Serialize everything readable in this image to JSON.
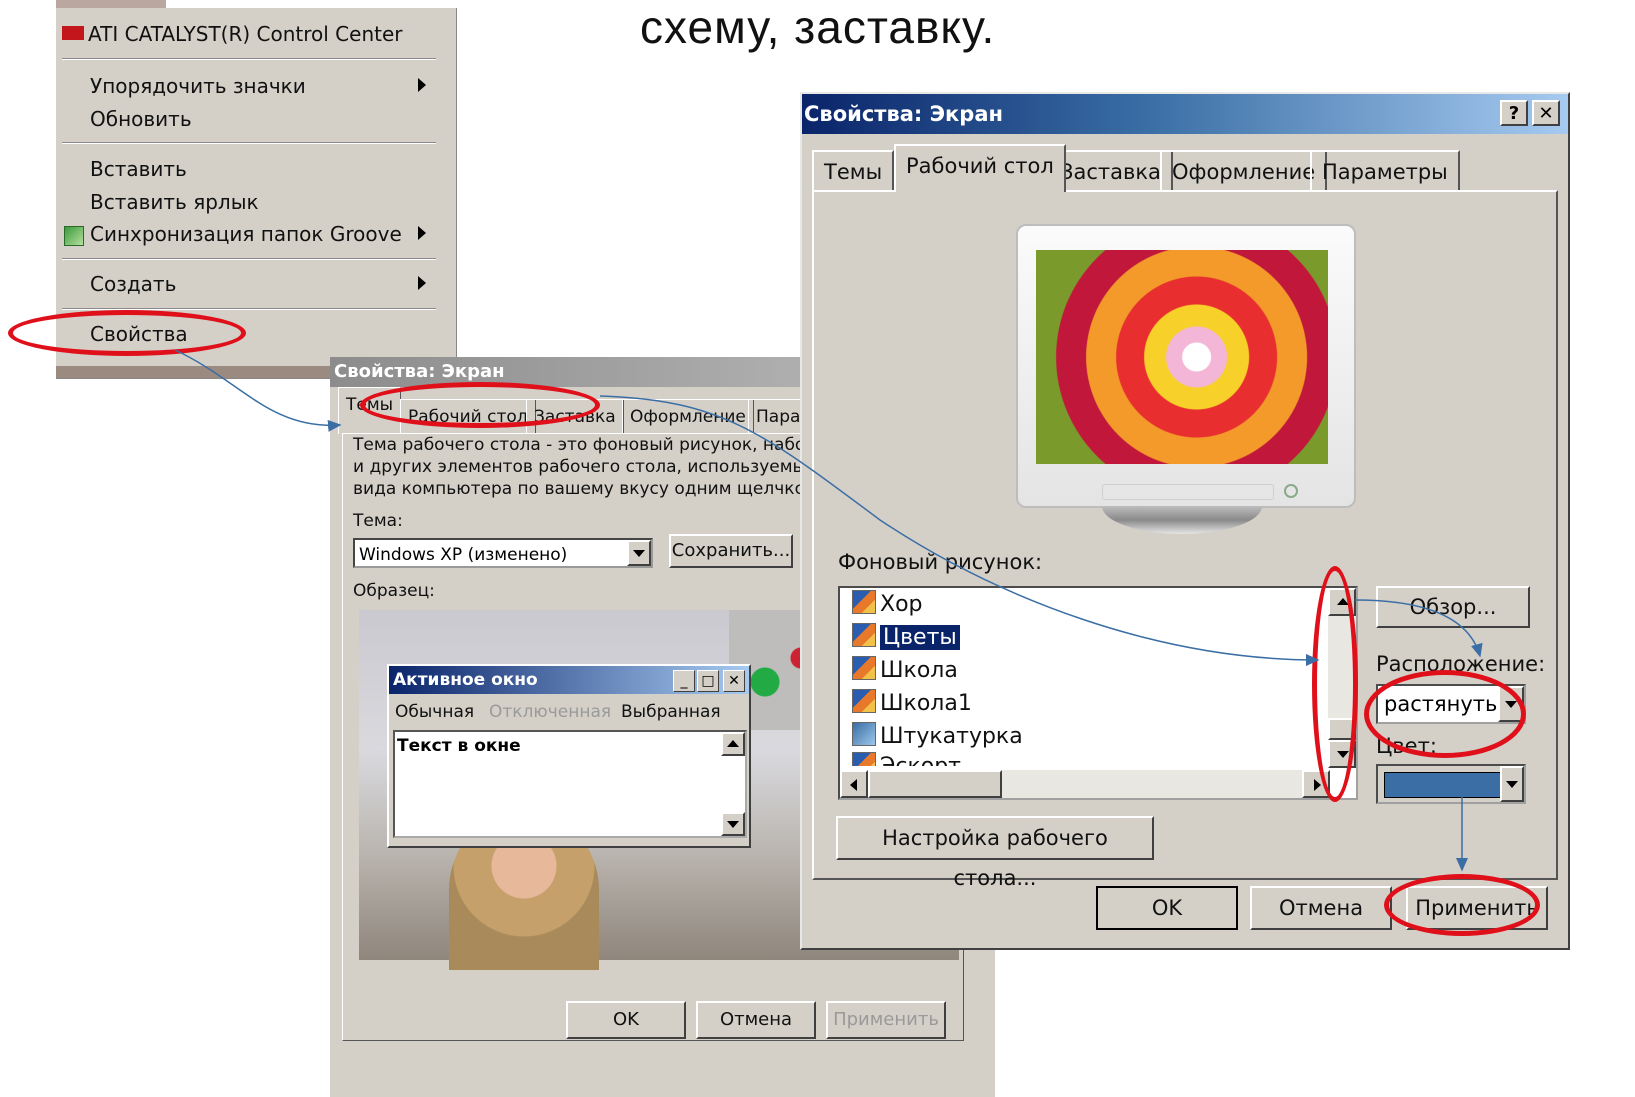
{
  "slide": {
    "heading": "схему, заставку."
  },
  "context_menu": {
    "header": "ATI CATALYST(R) Control Center",
    "items": [
      {
        "label": "Упорядочить значки",
        "submenu": true
      },
      {
        "label": "Обновить",
        "submenu": false
      },
      {
        "label": "Вставить",
        "submenu": false
      },
      {
        "label": "Вставить ярлык",
        "submenu": false
      },
      {
        "label": "Синхронизация папок Groove",
        "submenu": true
      },
      {
        "label": "Создать",
        "submenu": true
      },
      {
        "label": "Свойства",
        "submenu": false
      }
    ]
  },
  "dialog_small": {
    "title": "Свойства: Экран",
    "tabs": [
      "Темы",
      "Рабочий стол",
      "Заставка",
      "Оформление",
      "Пара"
    ],
    "description": [
      "Тема рабочего стола - это фоновый рисунок, набор зв",
      "и других элементов рабочего стола, используемый дл",
      "вида компьютера по вашему вкусу одним щелчком мы"
    ],
    "theme_label": "Тема:",
    "theme_value": "Windows XP (изменено)",
    "save_button": "Сохранить...",
    "sample_label": "Образец:",
    "sample_window": {
      "title": "Активное окно",
      "menu": [
        "Обычная",
        "Отключенная",
        "Выбранная"
      ],
      "body_text": "Текст в окне"
    },
    "buttons": {
      "ok": "OK",
      "cancel": "Отмена",
      "apply": "Применить"
    }
  },
  "dialog_main": {
    "title": "Свойства: Экран",
    "help_glyph": "?",
    "close_glyph": "✕",
    "tabs": [
      "Темы",
      "Рабочий стол",
      "Заставка",
      "Оформление",
      "Параметры"
    ],
    "active_tab": "Рабочий стол",
    "background_label": "Фоновый рисунок:",
    "background_list": [
      "Хор",
      "Цветы",
      "Школа",
      "Школа1",
      "Штукатурка",
      "Эскорт"
    ],
    "selected_background": "Цветы",
    "browse_button": "Обзор...",
    "position_label": "Расположение:",
    "position_value": "растянуть",
    "color_label": "Цвет:",
    "color_value": "#3a6ea5",
    "customize_button": "Настройка рабочего стола...",
    "buttons": {
      "ok": "OK",
      "cancel": "Отмена",
      "apply": "Применить"
    }
  },
  "colors": {
    "highlight_oval": "#e0101a",
    "arrow": "#3a6ea5",
    "title_bar": "#0a246a"
  }
}
